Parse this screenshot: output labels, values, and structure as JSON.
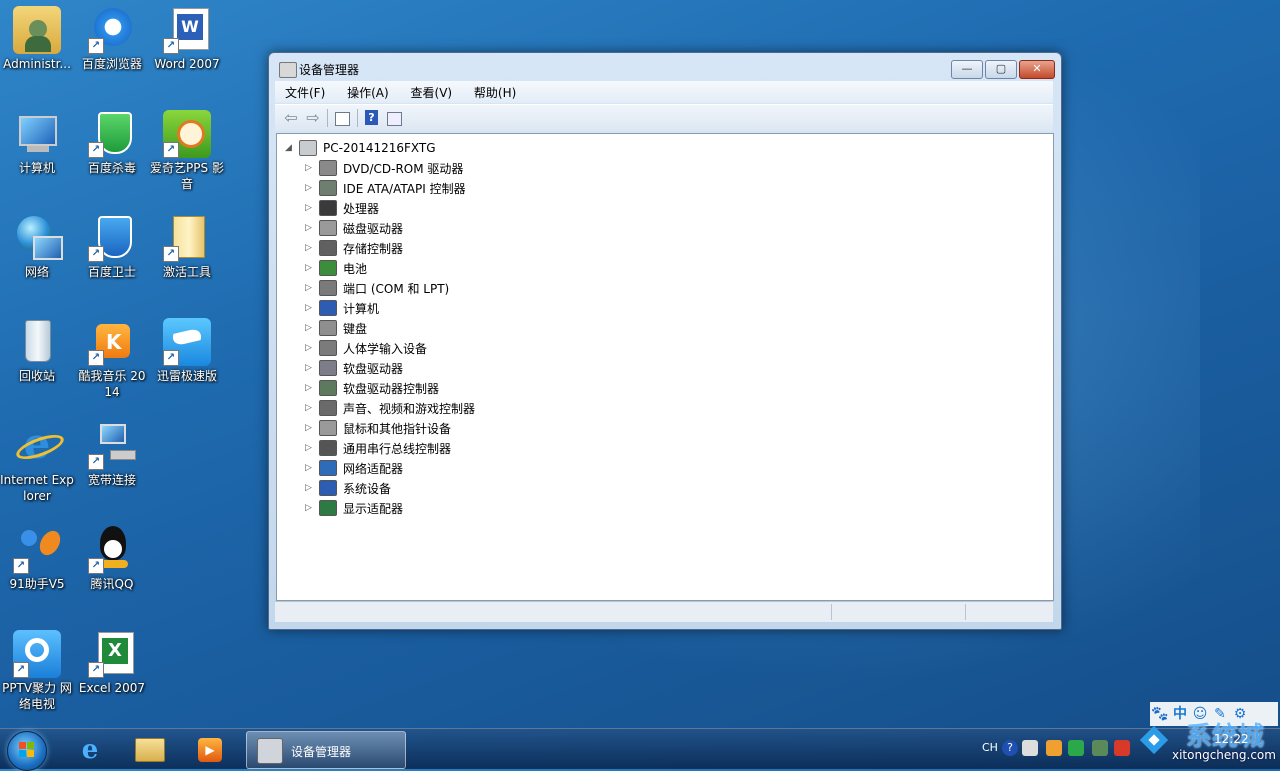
{
  "desktop": {
    "icons": [
      {
        "label": "Administr..."
      },
      {
        "label": "百度浏览器"
      },
      {
        "label": "Word 2007"
      },
      {
        "label": "计算机"
      },
      {
        "label": "百度杀毒"
      },
      {
        "label": "爱奇艺PPS 影音"
      },
      {
        "label": "网络"
      },
      {
        "label": "百度卫士"
      },
      {
        "label": "激活工具"
      },
      {
        "label": "回收站"
      },
      {
        "label": "酷我音乐 2014"
      },
      {
        "label": "迅雷极速版"
      },
      {
        "label": "Internet Explorer"
      },
      {
        "label": "宽带连接"
      },
      {
        "label": "91助手V5"
      },
      {
        "label": "腾讯QQ"
      },
      {
        "label": "PPTV聚力 网络电视"
      },
      {
        "label": "Excel 2007"
      }
    ]
  },
  "window": {
    "title": "设备管理器",
    "buttons": {
      "minimize": "—",
      "maximize": "▢",
      "close": "✕"
    },
    "menu": [
      "文件(F)",
      "操作(A)",
      "查看(V)",
      "帮助(H)"
    ],
    "toolbar": {
      "back": "⇦",
      "forward": "⇨",
      "help": "?"
    },
    "tree": {
      "root": "PC-20141216FXTG",
      "items": [
        {
          "label": "DVD/CD-ROM 驱动器",
          "icon": "dvd-drive-icon",
          "color": "#8a8a8a"
        },
        {
          "label": "IDE ATA/ATAPI 控制器",
          "icon": "ide-controller-icon",
          "color": "#6f7f6f"
        },
        {
          "label": "处理器",
          "icon": "processor-icon",
          "color": "#3a3a3a"
        },
        {
          "label": "磁盘驱动器",
          "icon": "disk-drive-icon",
          "color": "#9a9a9a"
        },
        {
          "label": "存储控制器",
          "icon": "storage-controller-icon",
          "color": "#606060"
        },
        {
          "label": "电池",
          "icon": "battery-icon",
          "color": "#3c8d3c"
        },
        {
          "label": "端口 (COM 和 LPT)",
          "icon": "port-icon",
          "color": "#7a7a7a"
        },
        {
          "label": "计算机",
          "icon": "computer-icon",
          "color": "#2d5db3"
        },
        {
          "label": "键盘",
          "icon": "keyboard-icon",
          "color": "#8f8f8f"
        },
        {
          "label": "人体学输入设备",
          "icon": "hid-icon",
          "color": "#7b7b7b"
        },
        {
          "label": "软盘驱动器",
          "icon": "floppy-drive-icon",
          "color": "#7d7d8a"
        },
        {
          "label": "软盘驱动器控制器",
          "icon": "floppy-controller-icon",
          "color": "#5e7a5e"
        },
        {
          "label": "声音、视频和游戏控制器",
          "icon": "sound-icon",
          "color": "#6a6a6a"
        },
        {
          "label": "鼠标和其他指针设备",
          "icon": "mouse-icon",
          "color": "#9a9a9a"
        },
        {
          "label": "通用串行总线控制器",
          "icon": "usb-icon",
          "color": "#555555"
        },
        {
          "label": "网络适配器",
          "icon": "network-adapter-icon",
          "color": "#2e6bb8"
        },
        {
          "label": "系统设备",
          "icon": "system-device-icon",
          "color": "#2d5db3"
        },
        {
          "label": "显示适配器",
          "icon": "display-adapter-icon",
          "color": "#2e7a44"
        }
      ]
    }
  },
  "taskbar": {
    "active_task": "设备管理器",
    "tray": {
      "language": "CH",
      "clock": "12:22"
    }
  },
  "watermark": {
    "toolbar": [
      "🐾",
      "中",
      "☺",
      "✎",
      "⚙"
    ],
    "name": "系统城",
    "url": "xitongcheng.com"
  }
}
